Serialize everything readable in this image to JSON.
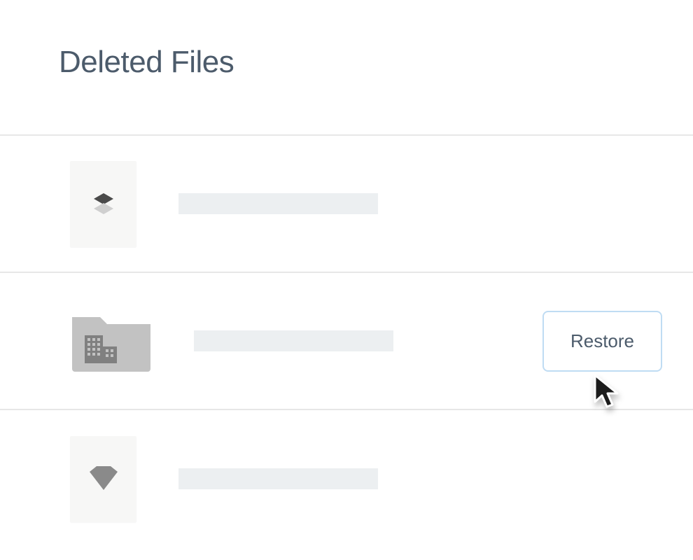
{
  "header": {
    "title": "Deleted Files"
  },
  "files": [
    {
      "icon": "dropbox-paper",
      "nameRedacted": true,
      "showRestore": false
    },
    {
      "icon": "team-folder",
      "nameRedacted": true,
      "showRestore": true
    },
    {
      "icon": "sketch-file",
      "nameRedacted": true,
      "showRestore": false
    }
  ],
  "actions": {
    "restoreLabel": "Restore"
  }
}
